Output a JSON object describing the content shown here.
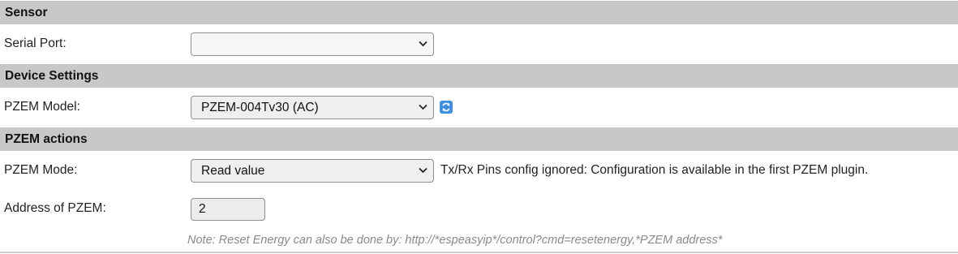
{
  "sections": {
    "sensor": {
      "title": "Sensor",
      "serial_port_label": "Serial Port:",
      "serial_port_value": ""
    },
    "device_settings": {
      "title": "Device Settings",
      "model_label": "PZEM Model:",
      "model_value": "PZEM-004Tv30 (AC)",
      "refresh_icon": "refresh-icon"
    },
    "actions": {
      "title": "PZEM actions",
      "mode_label": "PZEM Mode:",
      "mode_value": "Read value",
      "mode_note": "Tx/Rx Pins config ignored: Configuration is available in the first PZEM plugin.",
      "address_label": "Address of PZEM:",
      "address_value": "2",
      "footer_note": "Note: Reset Energy can also be done by: http://*espeasyip*/control?cmd=resetenergy,*PZEM address*"
    }
  },
  "colors": {
    "header_bg": "#c8c8c8",
    "accent": "#3f8fe0"
  }
}
